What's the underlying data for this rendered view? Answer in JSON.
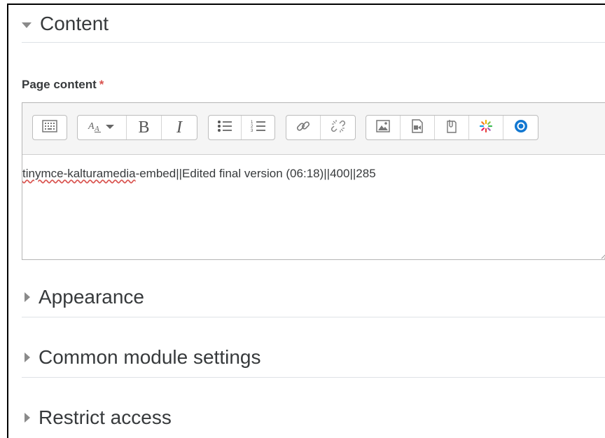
{
  "sections": {
    "content": {
      "title": "Content"
    },
    "appearance": {
      "title": "Appearance"
    },
    "common": {
      "title": "Common module settings"
    },
    "restrict": {
      "title": "Restrict access"
    }
  },
  "field": {
    "label": "Page content",
    "required_mark": "*"
  },
  "editor": {
    "text_misspelled": "tinymce-kalturamedia",
    "text_rest": "-embed||Edited final version (06:18)||400||285"
  },
  "toolbar": {
    "icons": [
      "toolbar-toggle-icon",
      "font-style-icon",
      "bold-icon",
      "italic-icon",
      "unordered-list-icon",
      "ordered-list-icon",
      "link-icon",
      "unlink-icon",
      "image-icon",
      "media-icon",
      "manage-files-icon",
      "kaltura-icon",
      "record-icon"
    ],
    "bold_glyph": "B",
    "italic_glyph": "I"
  },
  "colors": {
    "required": "#d9534f",
    "record_blue": "#1177d1",
    "heading": "#373a3c"
  }
}
